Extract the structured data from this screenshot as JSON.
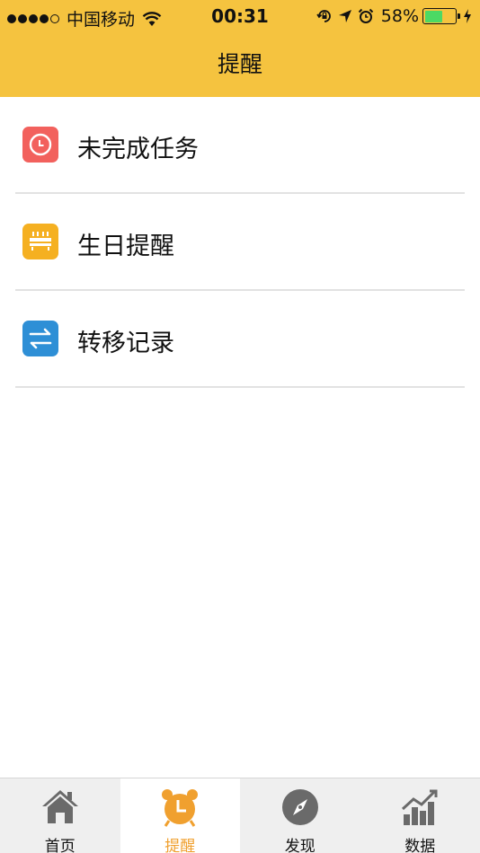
{
  "status_bar": {
    "carrier": "中国移动",
    "time": "00:31",
    "battery_percent": "58%",
    "battery_level": 0.58
  },
  "nav": {
    "title": "提醒"
  },
  "list": [
    {
      "label": "未完成任务",
      "icon": "clock-icon",
      "color": "#f2615d"
    },
    {
      "label": "生日提醒",
      "icon": "birthday-cake-icon",
      "color": "#f5b021"
    },
    {
      "label": "转移记录",
      "icon": "transfer-arrows-icon",
      "color": "#2e8fd6"
    }
  ],
  "tabs": [
    {
      "label": "首页",
      "icon": "home-icon"
    },
    {
      "label": "提醒",
      "icon": "alarm-clock-icon",
      "active": true
    },
    {
      "label": "发现",
      "icon": "compass-icon"
    },
    {
      "label": "数据",
      "icon": "chart-icon"
    }
  ],
  "colors": {
    "header": "#f5c33f",
    "active_tab": "#f0a02f",
    "battery": "#4cd964"
  }
}
